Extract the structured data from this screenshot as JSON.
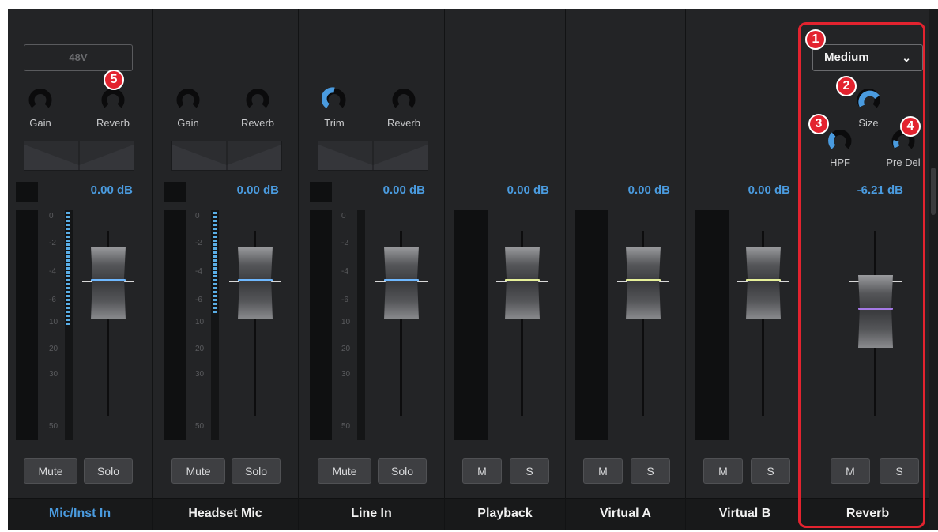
{
  "phantom_power_label": "48V",
  "channels": [
    {
      "name": "Mic/Inst In",
      "knob1": "Gain",
      "knob2": "Reverb",
      "db": "0.00 dB",
      "mute": "Mute",
      "solo": "Solo"
    },
    {
      "name": "Headset Mic",
      "knob1": "Gain",
      "knob2": "Reverb",
      "db": "0.00 dB",
      "mute": "Mute",
      "solo": "Solo"
    },
    {
      "name": "Line In",
      "knob1": "Trim",
      "knob2": "Reverb",
      "db": "0.00 dB",
      "mute": "Mute",
      "solo": "Solo"
    },
    {
      "name": "Playback",
      "db": "0.00 dB",
      "mute": "M",
      "solo": "S"
    },
    {
      "name": "Virtual A",
      "db": "0.00 dB",
      "mute": "M",
      "solo": "S"
    },
    {
      "name": "Virtual B",
      "db": "0.00 dB",
      "mute": "M",
      "solo": "S"
    }
  ],
  "reverb": {
    "name": "Reverb",
    "preset": "Medium",
    "size_label": "Size",
    "hpf_label": "HPF",
    "predelay_label": "Pre Del",
    "db": "-6.21 dB",
    "mute": "M",
    "solo": "S"
  },
  "meter_scale": [
    "0",
    "-2",
    "-4",
    "-6",
    "10",
    "20",
    "30",
    "50"
  ],
  "markers": [
    "1",
    "2",
    "3",
    "4",
    "5"
  ],
  "colors": {
    "accent_blue": "#4a9bdf",
    "fader_line_blue": "#6fb8ff",
    "fader_line_yellow": "#e6f09a",
    "fader_line_purple": "#a57ae6",
    "highlight_red": "#e3232f"
  },
  "icons": {
    "dropdown": "chevron-down-icon"
  }
}
